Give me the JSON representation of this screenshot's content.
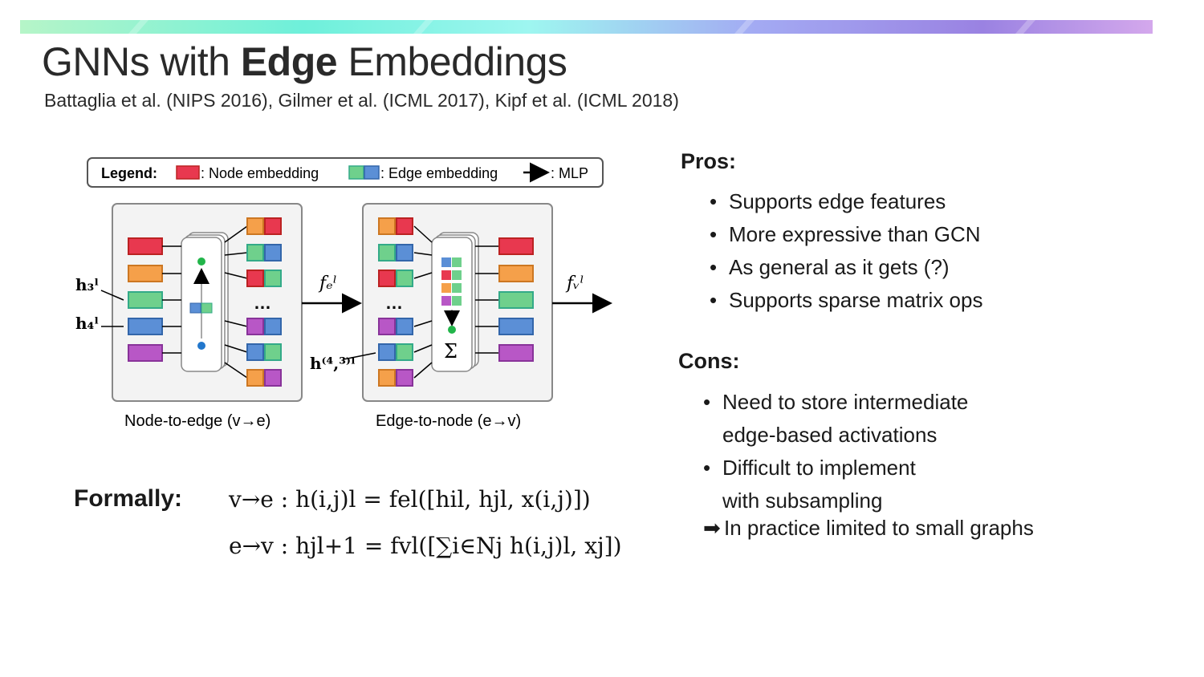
{
  "title": {
    "prefix": "GNNs with ",
    "bold": "Edge",
    "suffix": " Embeddings"
  },
  "subtitle": "Battaglia et al. (NIPS 2016), Gilmer et al. (ICML 2017), Kipf et al. (ICML 2018)",
  "legend": {
    "label": "Legend:",
    "node": ": Node embedding",
    "edge": ": Edge embedding",
    "mlp": ": MLP"
  },
  "diagram": {
    "caption_left": "Node-to-edge (v→e)",
    "caption_right": "Edge-to-node (e→v)",
    "h3": "h₃ˡ",
    "h4": "h₄ˡ",
    "h43": "h⁽⁴,³⁾ˡ",
    "fe": "fₑˡ",
    "fv": "fᵥˡ",
    "dots": "…",
    "sigma": "Σ"
  },
  "formally": "Formally:",
  "equations": {
    "eq1": "v→e :  h(i,j)l = fel([hil, hjl, x(i,j)])",
    "eq2": "e→v :  hjl+1 = fvl([∑i∈Nj h(i,j)l, xj])"
  },
  "pros": {
    "heading": "Pros:",
    "items": [
      "Supports edge features",
      "More expressive than GCN",
      "As general as it gets (?)",
      "Supports sparse matrix ops"
    ]
  },
  "cons": {
    "heading": "Cons:",
    "items": [
      [
        "Need to store intermediate",
        "edge-based activations"
      ],
      [
        "Difficult to implement",
        "with subsampling"
      ]
    ],
    "note": "In practice limited to small graphs"
  },
  "colors": {
    "red": "#e8384f",
    "orange": "#f5a04a",
    "green": "#6fd08c",
    "blue": "#5b8fd6",
    "purple": "#b857c6",
    "bar": [
      "#8ef0b0",
      "#5ee8d9",
      "#9ef3f0",
      "#9aa3f0",
      "#a17fe0",
      "#d2a3ea"
    ]
  }
}
